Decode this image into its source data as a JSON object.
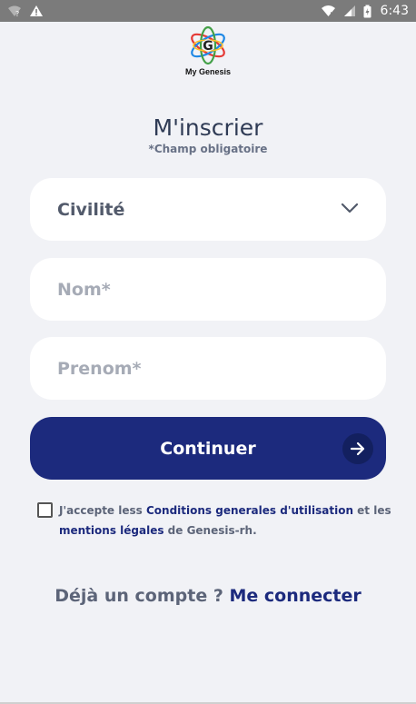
{
  "status_bar": {
    "time": "6:43",
    "icons": [
      "wifi-question-icon",
      "warning-icon",
      "wifi-icon",
      "signal-icon",
      "battery-charging-icon"
    ]
  },
  "logo": {
    "text": "My Genesis"
  },
  "page": {
    "title": "M'inscrier",
    "subtitle": "*Champ obligatoire"
  },
  "form": {
    "civilite_label": "Civilité",
    "nom_placeholder": "Nom*",
    "prenom_placeholder": "Prenom*",
    "nom_value": "",
    "prenom_value": ""
  },
  "button": {
    "label": "Continuer"
  },
  "terms": {
    "checked": false,
    "part1": "J'accepte less ",
    "link1": "Conditions generales d'utilisation",
    "part2": " et les ",
    "link2": "mentions légales",
    "part3": " de Genesis-rh."
  },
  "login": {
    "prefix": "Déjà un compte ? ",
    "link": "Me connecter"
  },
  "colors": {
    "primary": "#1c2a7d",
    "background": "#f1f2f6",
    "status_bar": "#7b7b7b"
  }
}
